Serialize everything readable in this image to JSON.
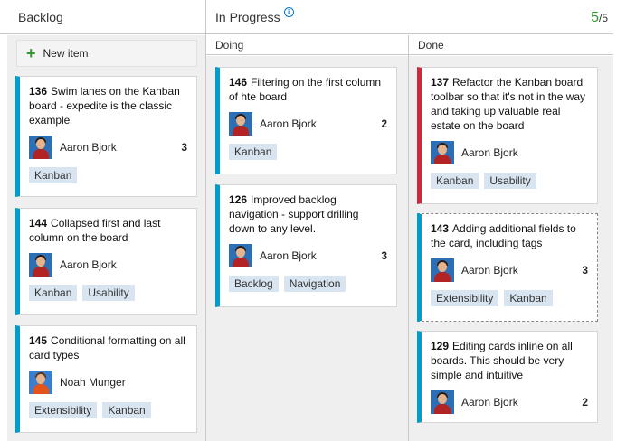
{
  "columns": {
    "backlog": {
      "title": "Backlog"
    },
    "in_progress": {
      "title": "In Progress",
      "wip_current": "5",
      "wip_limit": "/5",
      "sub": {
        "doing": "Doing",
        "done": "Done"
      }
    }
  },
  "new_item_label": "New item",
  "icons": {
    "add": "plus-icon",
    "info": "info-icon"
  },
  "colors": {
    "card_accent": "#009ccc",
    "card_accent_bug": "#cc293d",
    "wip_ok": "#339933",
    "tag_bg": "#d8e4f0"
  },
  "cards": {
    "c136": {
      "id": "136",
      "title": "Swim lanes on the Kanban board - expedite is the classic example",
      "assignee": "Aaron Bjork",
      "effort": "3",
      "tags": [
        "Kanban"
      ]
    },
    "c144": {
      "id": "144",
      "title": "Collapsed first and last column on the board",
      "assignee": "Aaron Bjork",
      "effort": "",
      "tags": [
        "Kanban",
        "Usability"
      ]
    },
    "c145": {
      "id": "145",
      "title": "Conditional formatting on all card types",
      "assignee": "Noah Munger",
      "effort": "",
      "tags": [
        "Extensibility",
        "Kanban"
      ]
    },
    "c146": {
      "id": "146",
      "title": "Filtering on the first column of hte board",
      "assignee": "Aaron Bjork",
      "effort": "2",
      "tags": [
        "Kanban"
      ]
    },
    "c126": {
      "id": "126",
      "title": "Improved backlog navigation - support drilling down to any level.",
      "assignee": "Aaron Bjork",
      "effort": "3",
      "tags": [
        "Backlog",
        "Navigation"
      ]
    },
    "c137": {
      "id": "137",
      "title": "Refactor the Kanban board toolbar so that it's not in the way and taking up valuable real estate on the board",
      "assignee": "Aaron Bjork",
      "effort": "",
      "tags": [
        "Kanban",
        "Usability"
      ]
    },
    "c143": {
      "id": "143",
      "title": "Adding additional fields to the card, including tags",
      "assignee": "Aaron Bjork",
      "effort": "3",
      "tags": [
        "Extensibility",
        "Kanban"
      ]
    },
    "c129": {
      "id": "129",
      "title": "Editing cards inline on all boards.  This should be very simple and intuitive",
      "assignee": "Aaron Bjork",
      "effort": "2",
      "tags": []
    }
  }
}
